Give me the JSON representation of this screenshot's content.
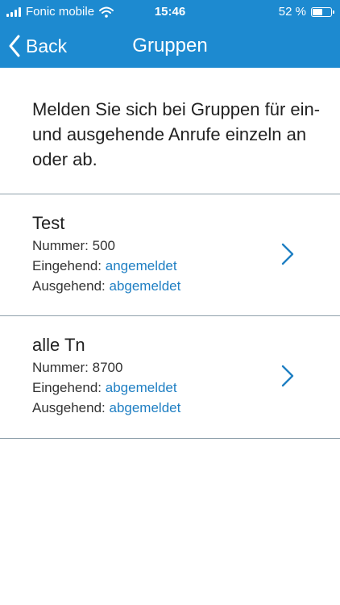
{
  "status_bar": {
    "carrier": "Fonic mobile",
    "time": "15:46",
    "battery": "52 %",
    "battery_level": 0.52,
    "icons": [
      "signal-icon",
      "wifi-icon",
      "battery-icon"
    ]
  },
  "nav": {
    "back_label": "Back",
    "title": "Gruppen",
    "back_icon": "chevron-left-icon",
    "bar_color": "#1d8ad0"
  },
  "intro_text": "Melden Sie sich bei Gruppen für ein- und ausgehende Anrufe einzeln an oder ab.",
  "link_color": "#1f7fc3",
  "groups": [
    {
      "name": "Test",
      "number_label": "Nummer:",
      "number": "500",
      "incoming_label": "Eingehend:",
      "incoming_status": "angemeldet",
      "outgoing_label": "Ausgehend:",
      "outgoing_status": "abgemeldet"
    },
    {
      "name": "alle Tn",
      "number_label": "Nummer:",
      "number": "8700",
      "incoming_label": "Eingehend:",
      "incoming_status": "abgemeldet",
      "outgoing_label": "Ausgehend:",
      "outgoing_status": "abgemeldet"
    }
  ]
}
